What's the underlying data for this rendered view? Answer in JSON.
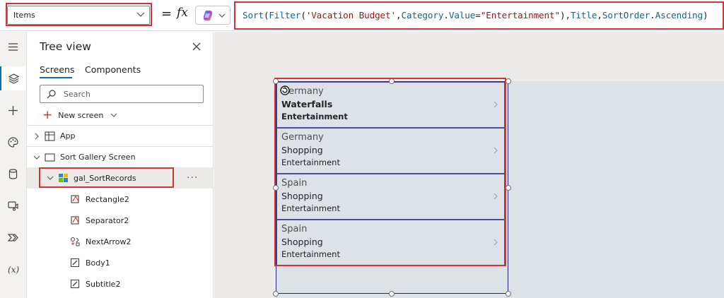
{
  "formula_bar": {
    "property": "Items",
    "equals": "=",
    "fx": "fx",
    "formula_tokens": [
      {
        "t": "Sort",
        "k": "fn"
      },
      {
        "t": "(",
        "k": "plain"
      },
      {
        "t": "Filter",
        "k": "fn"
      },
      {
        "t": "(",
        "k": "plain"
      },
      {
        "t": "'Vacation Budget'",
        "k": "str"
      },
      {
        "t": ",",
        "k": "plain"
      },
      {
        "t": "Category",
        "k": "id"
      },
      {
        "t": ".",
        "k": "plain"
      },
      {
        "t": "Value",
        "k": "id"
      },
      {
        "t": "=",
        "k": "plain"
      },
      {
        "t": "\"Entertainment\"",
        "k": "str"
      },
      {
        "t": "),",
        "k": "plain"
      },
      {
        "t": "Title",
        "k": "id"
      },
      {
        "t": ",",
        "k": "plain"
      },
      {
        "t": "SortOrder",
        "k": "id"
      },
      {
        "t": ".",
        "k": "plain"
      },
      {
        "t": "Ascending",
        "k": "id"
      },
      {
        "t": ")",
        "k": "plain"
      }
    ]
  },
  "tree": {
    "title": "Tree view",
    "tabs": [
      "Screens",
      "Components"
    ],
    "search_placeholder": "Search",
    "new_screen": "New screen",
    "nodes": {
      "app": "App",
      "screen": "Sort Gallery Screen",
      "gallery": "gal_SortRecords",
      "more": "···",
      "children": [
        "Rectangle2",
        "Separator2",
        "NextArrow2",
        "Body1",
        "Subtitle2"
      ]
    }
  },
  "gallery": {
    "items": [
      {
        "country": "Germany",
        "title": "Waterfalls",
        "category": "Entertainment"
      },
      {
        "country": "Germany",
        "title": "Shopping",
        "category": "Entertainment"
      },
      {
        "country": "Spain",
        "title": "Shopping",
        "category": "Entertainment"
      },
      {
        "country": "Spain",
        "title": "Shopping",
        "category": "Entertainment"
      }
    ]
  },
  "colors": {
    "highlight": "#d13438",
    "accent": "#0f6cbd",
    "gallery_border": "#27277a"
  },
  "icons": [
    "hamburger-icon",
    "layers-icon",
    "plus-icon",
    "palette-icon",
    "database-icon",
    "media-icon",
    "power-automate-icon",
    "variables-icon",
    "close-icon",
    "search-icon",
    "chevron-right-icon",
    "chevron-down-icon",
    "screen-icon",
    "app-icon",
    "gallery-icon",
    "rectangle-icon",
    "icon-control-icon",
    "edit-icon",
    "next-arrow-icon",
    "rotate-icon"
  ]
}
